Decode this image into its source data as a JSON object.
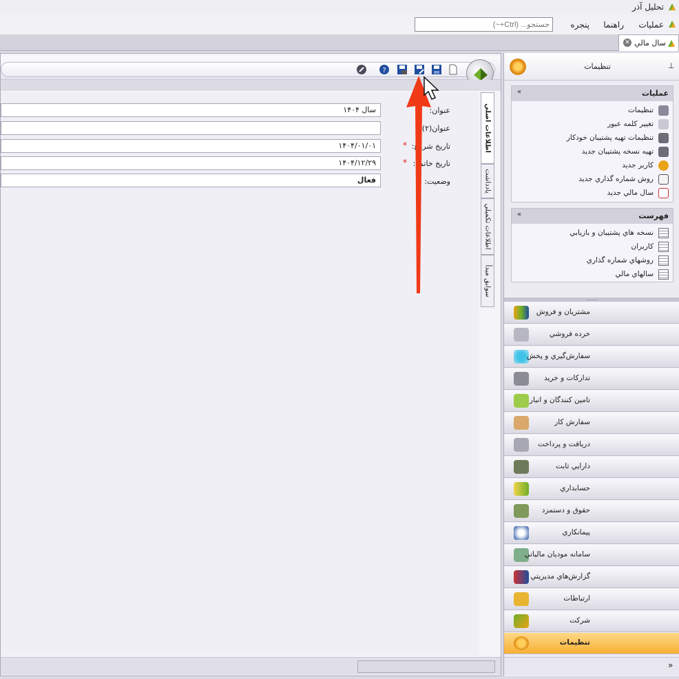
{
  "app": {
    "title": "تحلیل آذر"
  },
  "menu": {
    "items": [
      "عملیات",
      "راهنما",
      "پنجره"
    ],
    "search_placeholder": "جستجو... (Ctrl+~)"
  },
  "doc_tab": {
    "label": "سال مالي",
    "close": "✕"
  },
  "form": {
    "rows": [
      {
        "label": "عنوان:",
        "value": "سال ۱۴۰۴",
        "required": false
      },
      {
        "label": "عنوان(۲):",
        "value": "",
        "required": false
      },
      {
        "label": "تاريخ شروع:",
        "value": "۱۴۰۴/۰۱/۰۱",
        "required": true
      },
      {
        "label": "تاريخ خاتمه:",
        "value": "۱۴۰۴/۱۲/۲۹",
        "required": true
      },
      {
        "label": "وضعيت:",
        "value": "فعال",
        "required": false
      }
    ],
    "vtabs": [
      "اطلاعات اصلي",
      "يادداشت",
      "اطلاعات تكميلي",
      "سوابق مبدأ"
    ]
  },
  "right_panel": {
    "title": "تنظیمات",
    "pin": "⊥",
    "operations": {
      "title": "عمليات",
      "chevron": "«",
      "items": [
        "تنظيمات",
        "تغيير كلمه عبور",
        "تنظيمات تهيه پشتيبان خودكار",
        "تهيه نسخه پشتيبان جديد",
        "كاربر جديد",
        "روش شماره گذاري جديد",
        "سال مالي جديد"
      ]
    },
    "list": {
      "title": "فهرست",
      "chevron": "«",
      "items": [
        "نسخه هاي پشتيبان و بازيابي",
        "كاربران",
        "روشهاي شماره گذاري",
        "سالهاي مالي"
      ]
    },
    "splitter_dots": "......",
    "modules": [
      "مشتريان و فروش",
      "خرده فروشي",
      "سفارش‌گيري و پخش",
      "تداركات و خريد",
      "تامين كنندگان و انبار",
      "سفارش كار",
      "دريافت و پرداخت",
      "دارايي ثابت",
      "حسابداري",
      "حقوق و دستمزد",
      "پيمانكاري",
      "سامانه موديان مالياتي",
      "گزارش‌هاي مديريتي",
      "ارتباطات",
      "شركت",
      "تنظيمات"
    ],
    "footer_chevron": "»"
  },
  "colors": {
    "accent_arrow": "#f03a17",
    "active_module": "#f7b033",
    "icon_blue": "#1f4e9e",
    "icon_green": "#6fae2a"
  }
}
